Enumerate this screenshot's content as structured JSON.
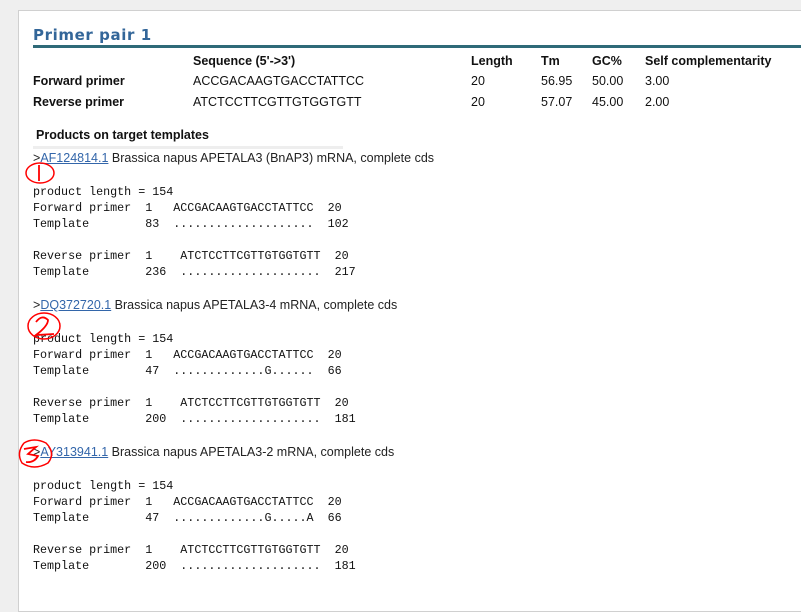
{
  "title": "Primer pair 1",
  "table": {
    "headers": [
      "",
      "Sequence (5'->3')",
      "Length",
      "Tm",
      "GC%",
      "Self complementarity"
    ],
    "rows": [
      [
        "Forward primer",
        "ACCGACAAGTGACCTATTCC",
        "20",
        "56.95",
        "50.00",
        "3.00"
      ],
      [
        "Reverse primer",
        "ATCTCCTTCGTTGTGGTGTT",
        "20",
        "57.07",
        "45.00",
        "2.00"
      ]
    ]
  },
  "products_heading": "Products on target templates",
  "products": [
    {
      "prefix": ">",
      "accession": "AF124814.1",
      "description": " Brassica napus APETALA3 (BnAP3) mRNA, complete cds",
      "annotation": "1",
      "alignment": "product length = 154\nForward primer  1   ACCGACAAGTGACCTATTCC  20\nTemplate        83  ....................  102\n\nReverse primer  1    ATCTCCTTCGTTGTGGTGTT  20\nTemplate        236  ....................  217"
    },
    {
      "prefix": ">",
      "accession": "DQ372720.1",
      "description": " Brassica napus APETALA3-4 mRNA, complete cds",
      "annotation": "2",
      "alignment": "product length = 154\nForward primer  1   ACCGACAAGTGACCTATTCC  20\nTemplate        47  .............G......  66\n\nReverse primer  1    ATCTCCTTCGTTGTGGTGTT  20\nTemplate        200  ....................  181"
    },
    {
      "prefix": ">",
      "accession": "AY313941.1",
      "description": " Brassica napus APETALA3-2 mRNA, complete cds",
      "annotation": "3",
      "alignment": "product length = 154\nForward primer  1   ACCGACAAGTGACCTATTCC  20\nTemplate        47  .............G.....A  66\n\nReverse primer  1    ATCTCCTTCGTTGTGGTGTT  20\nTemplate        200  ....................  181"
    }
  ],
  "colors": {
    "title": "#336699",
    "title_bar": "#2f6a78",
    "link": "#3366aa",
    "annotation": "#ff0000"
  }
}
